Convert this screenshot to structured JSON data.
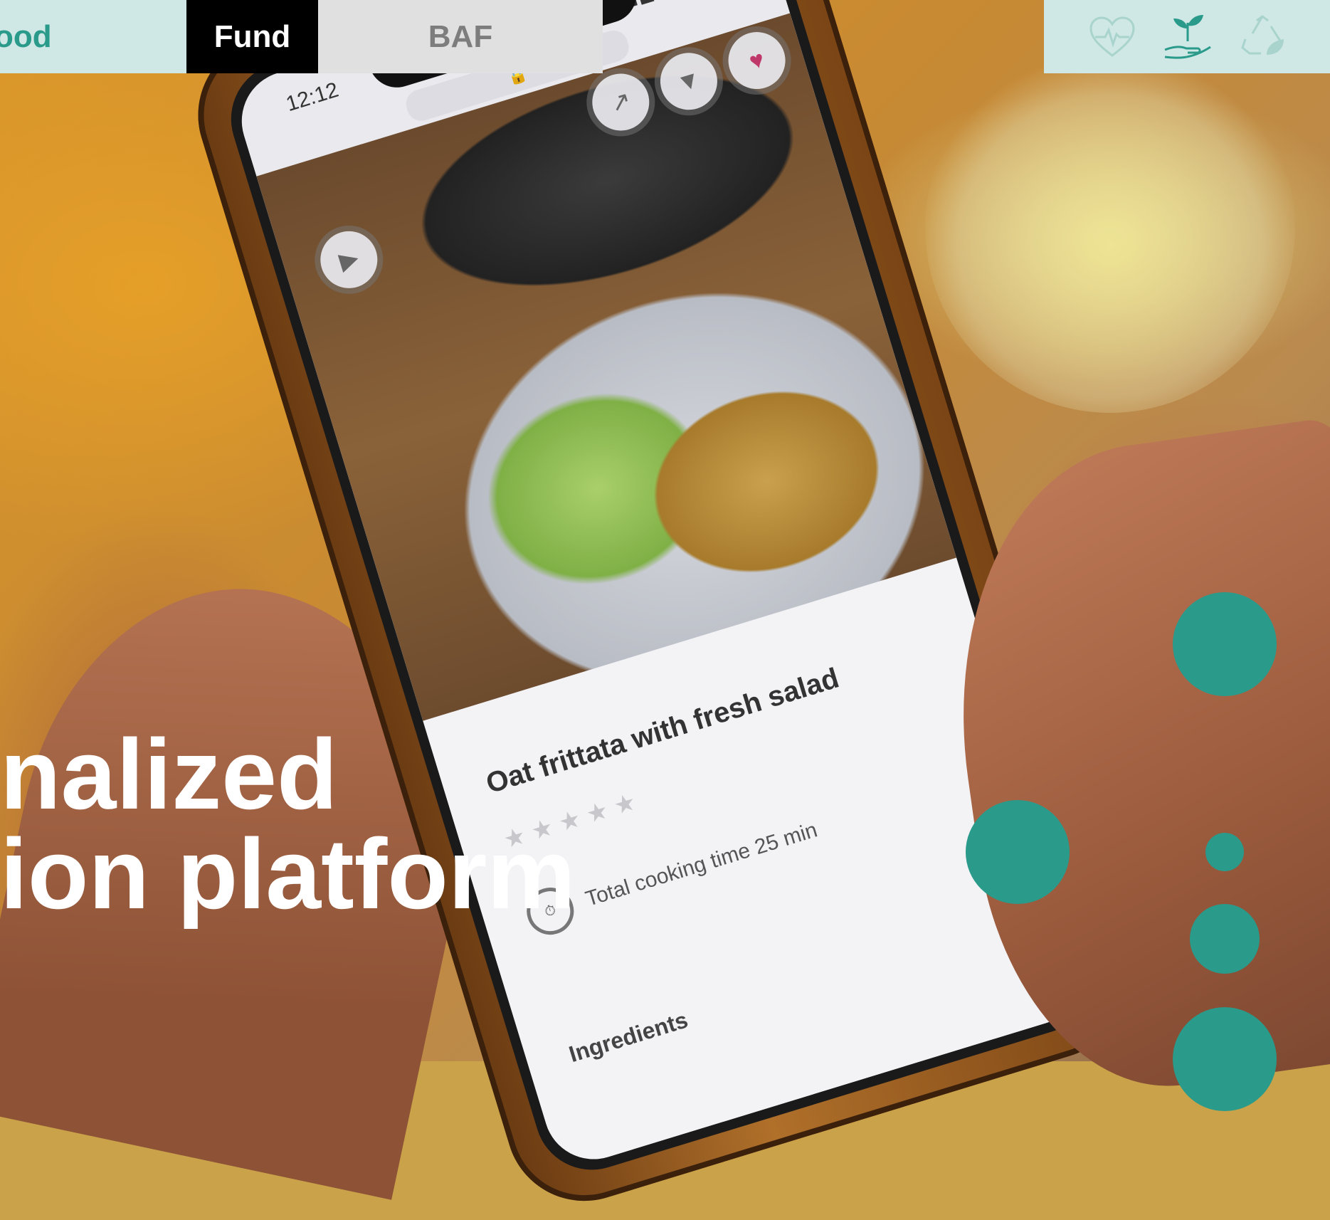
{
  "nav": {
    "brand_partial": "ood",
    "fund_label": "Fund",
    "baf_label": "BAF",
    "icons": [
      "heart-pulse-icon",
      "plant-hand-icon",
      "recycle-leaf-icon"
    ]
  },
  "phone": {
    "time": "12:12",
    "url": "",
    "recipe_title": "Oat frittata with fresh salad",
    "cooking_time": "Total cooking time 25 min",
    "ingredients_label": "Ingredients"
  },
  "hero": {
    "headline_line1": "nalized",
    "headline_line2": "ion platform"
  },
  "colors": {
    "accent": "#2a9a8b",
    "nav_bg": "#cfe8e5",
    "fund_bg": "#000000",
    "baf_bg": "#e0e0e0"
  }
}
